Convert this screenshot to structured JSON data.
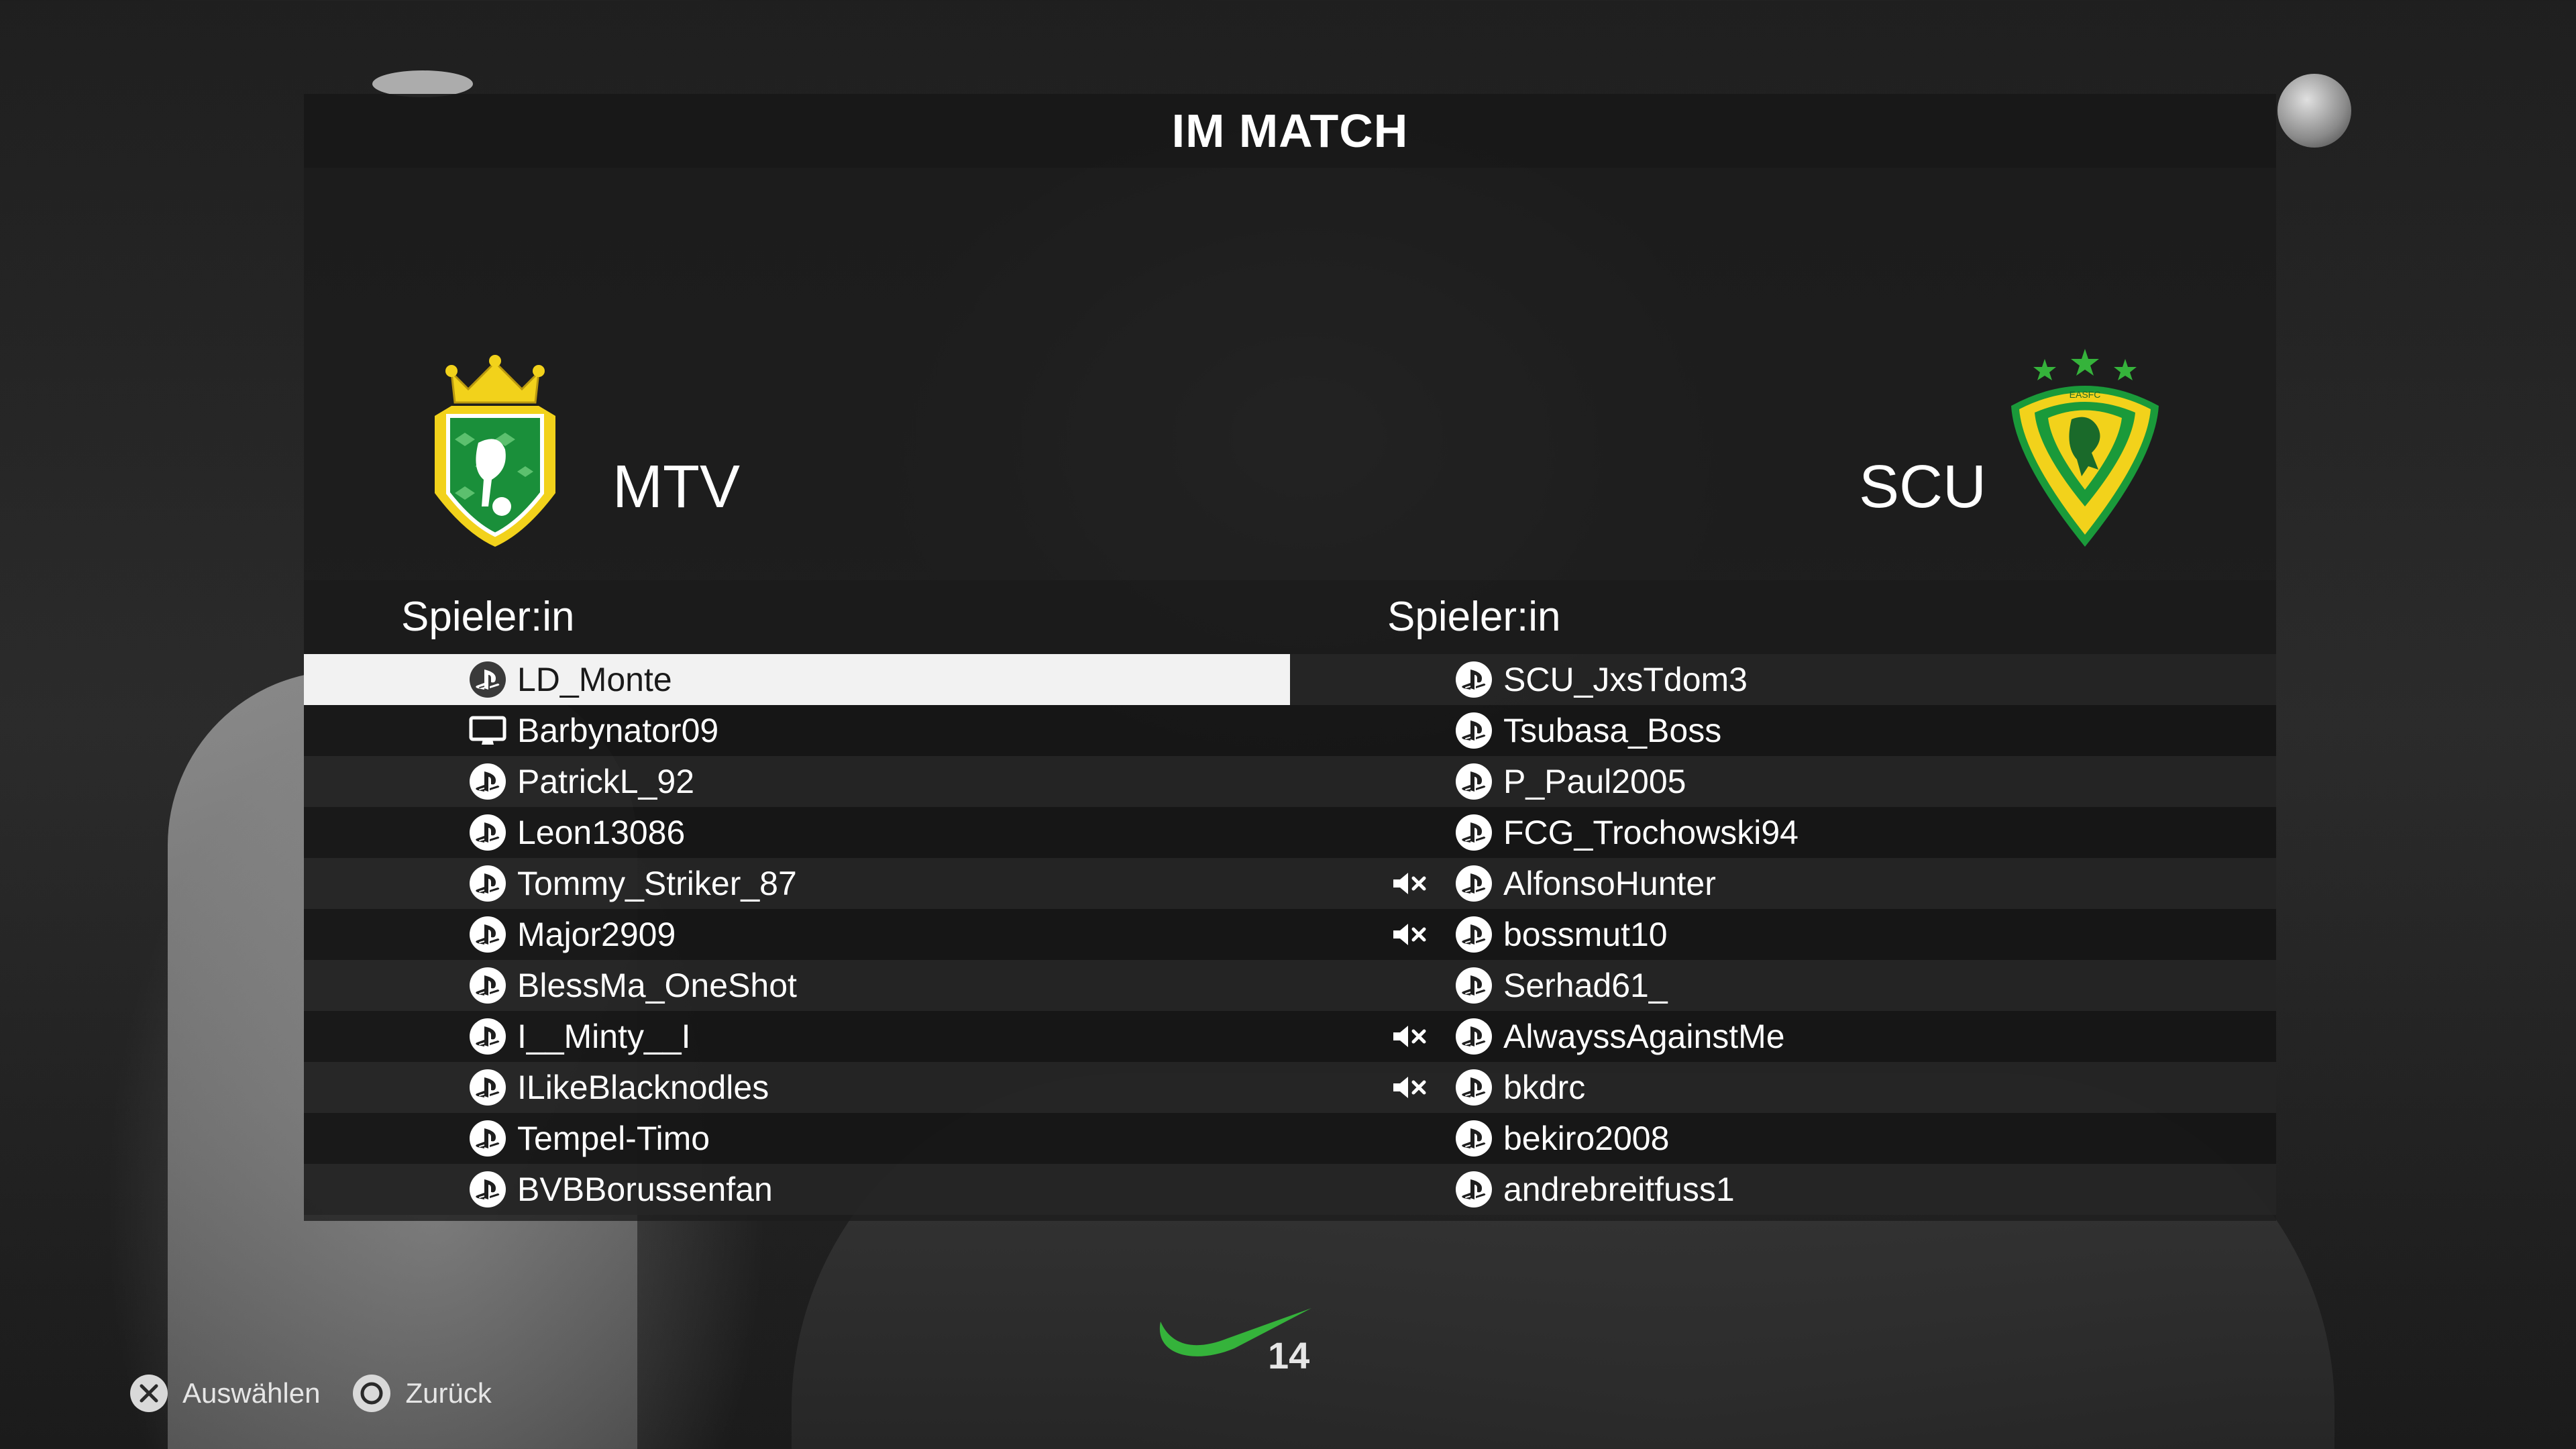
{
  "screen": {
    "title": "IM MATCH"
  },
  "teams": {
    "home": {
      "name": "MTV",
      "crest_icon": "mtv-crest",
      "crest_colors": [
        "#1a8f3a",
        "#f2d21b",
        "#ffffff"
      ]
    },
    "away": {
      "name": "SCU",
      "crest_icon": "scu-crest",
      "crest_colors": [
        "#f2d21b",
        "#1a9a3a"
      ]
    }
  },
  "columns": {
    "home_header": "Spieler:in",
    "away_header": "Spieler:in"
  },
  "home_players": [
    {
      "name": "LD_Monte",
      "platform": "playstation",
      "muted": false,
      "selected": true
    },
    {
      "name": "Barbynator09",
      "platform": "pc",
      "muted": false,
      "selected": false
    },
    {
      "name": "PatrickL_92",
      "platform": "playstation",
      "muted": false,
      "selected": false
    },
    {
      "name": "Leon13086",
      "platform": "playstation",
      "muted": false,
      "selected": false
    },
    {
      "name": "Tommy_Striker_87",
      "platform": "playstation",
      "muted": false,
      "selected": false
    },
    {
      "name": "Major2909",
      "platform": "playstation",
      "muted": false,
      "selected": false
    },
    {
      "name": "BlessMa_OneShot",
      "platform": "playstation",
      "muted": false,
      "selected": false
    },
    {
      "name": "I__Minty__I",
      "platform": "playstation",
      "muted": false,
      "selected": false
    },
    {
      "name": "ILikeBlacknodles",
      "platform": "playstation",
      "muted": false,
      "selected": false
    },
    {
      "name": "Tempel-Timo",
      "platform": "playstation",
      "muted": false,
      "selected": false
    },
    {
      "name": "BVBBorussenfan",
      "platform": "playstation",
      "muted": false,
      "selected": false
    }
  ],
  "away_players": [
    {
      "name": "SCU_JxsTdom3",
      "platform": "playstation",
      "muted": false
    },
    {
      "name": "Tsubasa_Boss",
      "platform": "playstation",
      "muted": false
    },
    {
      "name": "P_Paul2005",
      "platform": "playstation",
      "muted": false
    },
    {
      "name": "FCG_Trochowski94",
      "platform": "playstation",
      "muted": false
    },
    {
      "name": "AlfonsoHunter",
      "platform": "playstation",
      "muted": true
    },
    {
      "name": "bossmut10",
      "platform": "playstation",
      "muted": true
    },
    {
      "name": "Serhad61_",
      "platform": "playstation",
      "muted": false
    },
    {
      "name": "AlwayssAgainstMe",
      "platform": "playstation",
      "muted": true
    },
    {
      "name": "bkdrc",
      "platform": "playstation",
      "muted": true
    },
    {
      "name": "bekiro2008",
      "platform": "playstation",
      "muted": false
    },
    {
      "name": "andrebreitfuss1",
      "platform": "playstation",
      "muted": false
    }
  ],
  "footer": {
    "select": {
      "icon": "cross-button-icon",
      "label": "Auswählen"
    },
    "back": {
      "icon": "circle-button-icon",
      "label": "Zurück"
    }
  },
  "background": {
    "jersey_number": "14"
  },
  "colors": {
    "selected_row_bg": "#f2f2f2",
    "selected_row_text": "#1a1a1a",
    "accent_green": "#1a9a3a",
    "accent_yellow": "#f2d21b"
  }
}
